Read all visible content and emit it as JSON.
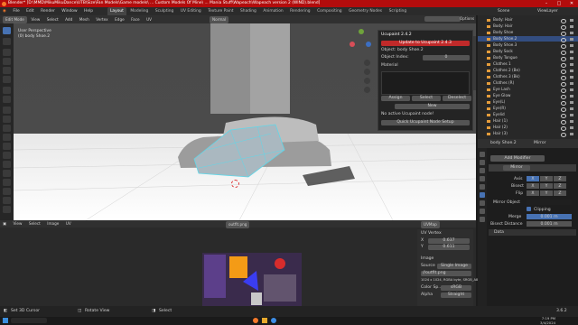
{
  "titlebar": {
    "title": "Blender* [D:\\MMD\\MikuMikuDance\\UTB\\Size\\Fan Models\\Game models\\ ... Custom Models Of Mine\\ ... Mania Stuff\\Wapeach\\Wapeach version 2 (WIND).blend]",
    "colors": {
      "bar": "#b30c0c"
    }
  },
  "menubar": {
    "items": [
      "File",
      "Edit",
      "Render",
      "Window",
      "Help"
    ],
    "workspaces": [
      "Layout",
      "Modeling",
      "Sculpting",
      "UV Editing",
      "Texture Paint",
      "Shading",
      "Animation",
      "Rendering",
      "Compositing",
      "Geometry Nodes",
      "Scripting"
    ],
    "active_workspace": "Layout",
    "scene": "Scene",
    "view_layer": "ViewLayer"
  },
  "viewport_header": {
    "mode": "Edit Mode",
    "menus": [
      "View",
      "Select",
      "Add",
      "Mesh",
      "Vertex",
      "Edge",
      "Face",
      "UV"
    ],
    "orientation": "Normal",
    "options": "Options"
  },
  "viewport": {
    "perspective": "User Perspective",
    "object": "(0) body Shoe.2",
    "accent": "#4772b3"
  },
  "ucupaint": {
    "tab_title": "Ucupaint 2.4.2",
    "update_label": "Update to Ucupaint 2.4.3",
    "object_label": "Object: body Shoe.2",
    "object_index_label": "Object Index:",
    "object_index_value": "0",
    "material_label": "Material",
    "buttons": [
      "Assign",
      "Select",
      "Deselect"
    ],
    "new_label": "New",
    "warning": "No active Ucupaint node!",
    "quick_setup": "Quick Ucupaint Node Setup"
  },
  "outliner": {
    "items": [
      "Body: Hair",
      "Body: Hair",
      "Body Shoe",
      "Body Shoe.2",
      "Body Shoe.3",
      "Body Sock",
      "Body Tongue",
      "Clothes 1",
      "Clothes 2 (Be)",
      "Clothes 3 (Bk)",
      "Clothes (R)",
      "Eye Lash",
      "Eye Glow",
      "Eye(L)",
      "Eye(R)",
      "Eyelid",
      "Hair (1)",
      "Hair (2)",
      "Hair (3)"
    ],
    "selected_index": 3
  },
  "properties": {
    "breadcrumb": [
      "body Shoe.2",
      "Mirror"
    ],
    "add_modifier": "Add Modifier",
    "modifier_name": "Mirror",
    "axis_label": "Axis",
    "bisect_label": "Bisect",
    "flip_label": "Flip",
    "axes": [
      "X",
      "Y",
      "Z"
    ],
    "mirror_object_label": "Mirror Object",
    "clipping_label": "Clipping",
    "merge_label": "Merge",
    "merge_value": "0.001 m",
    "bisect_distance_label": "Bisect Distance",
    "bisect_distance_value": "0.001 m",
    "data_label": "Data"
  },
  "image_editor": {
    "menus": [
      "View",
      "Select",
      "Image",
      "UV"
    ],
    "image_name": "outfit.png",
    "uvmap": "UVMap",
    "uv_vertex_label": "UV Vertex",
    "x_label": "X",
    "x_value": "0.637",
    "y_label": "Y",
    "y_value": "0.611",
    "image_label": "Image",
    "source_label": "Source",
    "source_value": "Single Image",
    "file_name": "//outfit.png",
    "file_info": "1024 x 1024,  RGBA byte,  SRGB_A8",
    "color_space_label": "Color Sp...",
    "color_space_value": "sRGB",
    "alpha_label": "Alpha",
    "alpha_value": "Straight"
  },
  "status_bar": {
    "left": "Set 3D Cursor",
    "middle": "Rotate View",
    "right": "Select",
    "version": "3.6.2"
  },
  "taskbar": {
    "time": "7:19 PM",
    "date": "3/4/2024"
  }
}
